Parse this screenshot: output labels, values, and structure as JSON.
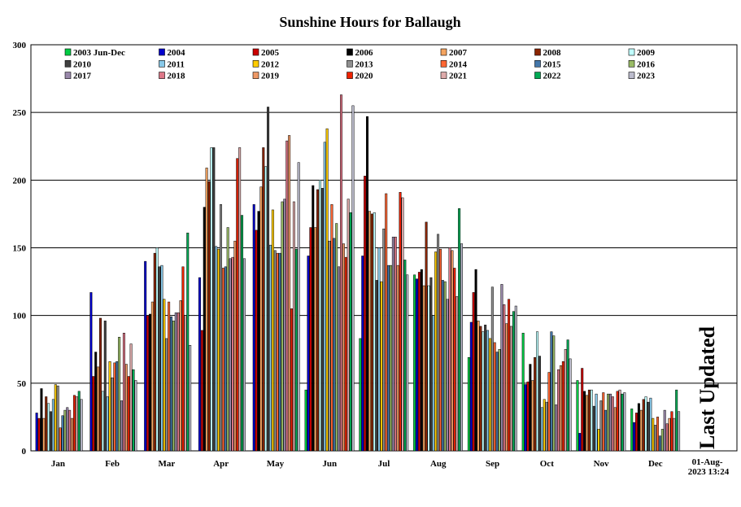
{
  "chart_data": {
    "type": "bar",
    "title": "Sunshine  Hours  for Ballaugh",
    "ylim": [
      0,
      300
    ],
    "yticks": [
      0,
      50,
      100,
      150,
      200,
      250,
      300
    ],
    "grid": true,
    "legend_position": "top",
    "categories": [
      "Jan",
      "Feb",
      "Mar",
      "Apr",
      "May",
      "Jun",
      "Jul",
      "Aug",
      "Sep",
      "Oct",
      "Nov",
      "Dec"
    ],
    "series": [
      {
        "name": "2003 Jun-Dec",
        "color": "#00cc44",
        "values": [
          null,
          null,
          null,
          null,
          null,
          45,
          83,
          130,
          69,
          87,
          52,
          31
        ]
      },
      {
        "name": "2004",
        "color": "#0000cc",
        "values": [
          28,
          117,
          140,
          128,
          182,
          144,
          144,
          127,
          95,
          49,
          13,
          21
        ]
      },
      {
        "name": "2005",
        "color": "#cc0000",
        "values": [
          24,
          55,
          100,
          89,
          163,
          165,
          203,
          132,
          117,
          51,
          61,
          28
        ]
      },
      {
        "name": "2006",
        "color": "#000000",
        "values": [
          46,
          73,
          101,
          180,
          177,
          196,
          247,
          134,
          134,
          64,
          44,
          35
        ]
      },
      {
        "name": "2007",
        "color": "#f4a460",
        "values": [
          24,
          62,
          110,
          209,
          195,
          165,
          177,
          122,
          96,
          52,
          41,
          30
        ]
      },
      {
        "name": "2008",
        "color": "#8b2500",
        "values": [
          40,
          98,
          146,
          199,
          224,
          193,
          175,
          169,
          92,
          69,
          45,
          38
        ]
      },
      {
        "name": "2009",
        "color": "#c0ffff",
        "values": [
          35,
          44,
          150,
          224,
          210,
          200,
          176,
          122,
          88,
          88,
          45,
          40
        ]
      },
      {
        "name": "2010",
        "color": "#404040",
        "values": [
          29,
          96,
          136,
          224,
          254,
          194,
          126,
          128,
          93,
          70,
          33,
          36
        ]
      },
      {
        "name": "2011",
        "color": "#88c8e8",
        "values": [
          38,
          40,
          137,
          151,
          152,
          228,
          150,
          100,
          89,
          32,
          42,
          39
        ]
      },
      {
        "name": "2012",
        "color": "#ffcc00",
        "values": [
          49,
          66,
          112,
          149,
          178,
          238,
          125,
          147,
          83,
          38,
          16,
          24
        ]
      },
      {
        "name": "2013",
        "color": "#909090",
        "values": [
          48,
          54,
          83,
          182,
          148,
          155,
          164,
          160,
          121,
          36,
          37,
          19
        ]
      },
      {
        "name": "2014",
        "color": "#ff6633",
        "values": [
          17,
          65,
          110,
          135,
          146,
          182,
          190,
          149,
          80,
          58,
          43,
          25
        ]
      },
      {
        "name": "2015",
        "color": "#4477aa",
        "values": [
          26,
          66,
          99,
          136,
          146,
          157,
          137,
          126,
          73,
          88,
          30,
          11
        ]
      },
      {
        "name": "2016",
        "color": "#99bb66",
        "values": [
          30,
          84,
          96,
          165,
          184,
          168,
          137,
          125,
          75,
          85,
          42,
          16
        ]
      },
      {
        "name": "2017",
        "color": "#9988aa",
        "values": [
          32,
          37,
          102,
          142,
          186,
          136,
          158,
          112,
          123,
          34,
          42,
          30
        ]
      },
      {
        "name": "2018",
        "color": "#dd7788",
        "values": [
          30,
          87,
          102,
          143,
          229,
          263,
          158,
          150,
          108,
          60,
          40,
          20
        ]
      },
      {
        "name": "2019",
        "color": "#ee9966",
        "values": [
          24,
          64,
          111,
          155,
          233,
          153,
          137,
          148,
          94,
          63,
          32,
          24
        ]
      },
      {
        "name": "2020",
        "color": "#ee2200",
        "values": [
          41,
          55,
          136,
          216,
          105,
          143,
          191,
          135,
          112,
          66,
          44,
          29
        ]
      },
      {
        "name": "2021",
        "color": "#ddaaaa",
        "values": [
          40,
          79,
          100,
          224,
          184,
          186,
          187,
          114,
          92,
          75,
          45,
          24
        ]
      },
      {
        "name": "2022",
        "color": "#00aa55",
        "values": [
          44,
          60,
          161,
          174,
          149,
          176,
          141,
          179,
          103,
          82,
          42,
          45
        ]
      },
      {
        "name": "2023",
        "color": "#bbbbcc",
        "values": [
          38,
          52,
          78,
          142,
          213,
          255,
          130,
          153,
          107,
          68,
          43,
          29
        ]
      }
    ],
    "last_updated_label": "Last Updated",
    "last_updated_time": "01-Aug-2023 13:24"
  }
}
